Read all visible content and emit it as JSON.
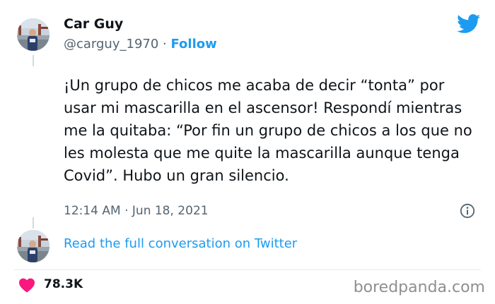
{
  "author": {
    "display_name": "Car Guy",
    "handle": "@carguy_1970",
    "separator": " · ",
    "follow_label": "Follow"
  },
  "tweet": {
    "text": "¡Un grupo de chicos me acaba de decir “tonta” por usar mi mascarilla en el ascensor! Respondí mientras me la quitaba: “Por fin un grupo de chicos a los que no les molesta que me quite la mascarilla aunque tenga Covid”. Hubo un gran silencio.",
    "timestamp": "12:14 AM · Jun 18, 2021"
  },
  "conversation_link": "Read the full conversation on Twitter",
  "engagement": {
    "likes": "78.3K"
  },
  "watermark": "boredpanda.com",
  "colors": {
    "accent": "#1d9bf0",
    "heart": "#f91880",
    "text": "#0f1419",
    "secondary_text": "#536471"
  },
  "icons": {
    "brand": "twitter-bird-icon",
    "info": "info-icon",
    "like": "heart-icon"
  }
}
